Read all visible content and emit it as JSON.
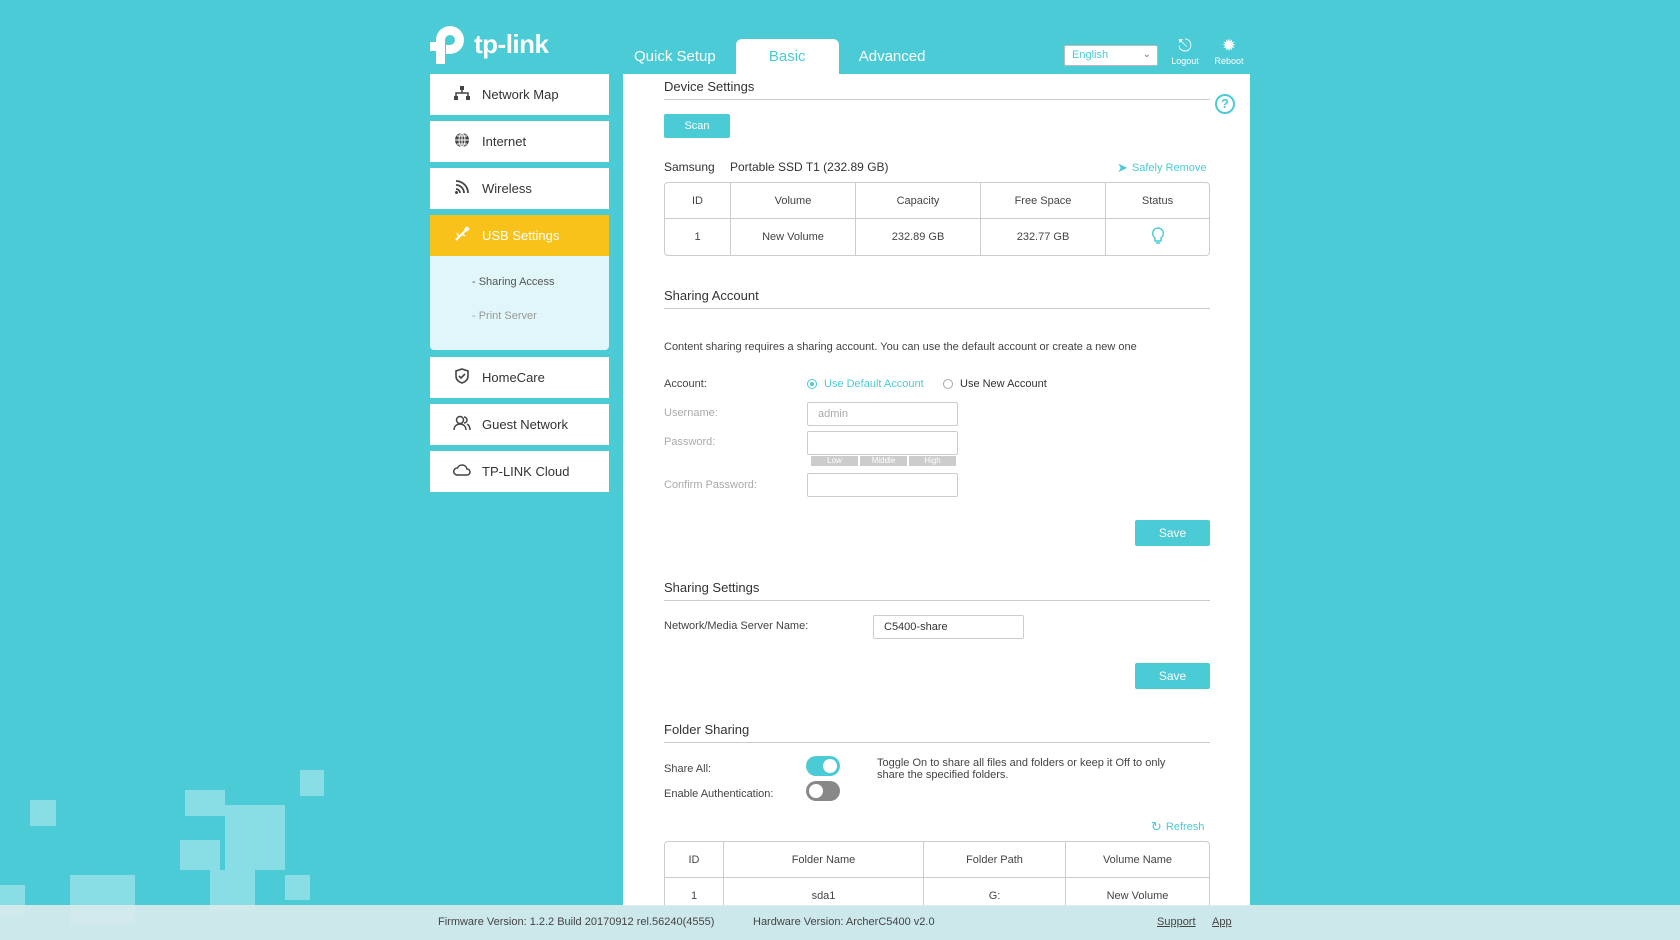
{
  "brand": {
    "name": "tp-link"
  },
  "topnav": {
    "tabs": [
      {
        "label": "Quick Setup"
      },
      {
        "label": "Basic"
      },
      {
        "label": "Advanced"
      }
    ]
  },
  "header": {
    "language": "English",
    "logout_label": "Logout",
    "reboot_label": "Reboot"
  },
  "sidebar": {
    "items": [
      {
        "label": "Network Map",
        "icon": "network-map-icon"
      },
      {
        "label": "Internet",
        "icon": "globe-icon"
      },
      {
        "label": "Wireless",
        "icon": "wifi-icon"
      },
      {
        "label": "USB Settings",
        "icon": "usb-icon"
      },
      {
        "label": "HomeCare",
        "icon": "shield-icon"
      },
      {
        "label": "Guest Network",
        "icon": "users-icon"
      },
      {
        "label": "TP-LINK Cloud",
        "icon": "cloud-icon"
      }
    ],
    "usb_sub": [
      {
        "label": "- Sharing Access"
      },
      {
        "label": "- Print Server"
      }
    ]
  },
  "device_settings": {
    "title": "Device Settings",
    "scan_label": "Scan",
    "device_brand": "Samsung",
    "device_model": "Portable SSD T1 (232.89 GB)",
    "safely_remove_label": "Safely Remove",
    "table": {
      "headers": [
        "ID",
        "Volume",
        "Capacity",
        "Free Space",
        "Status"
      ],
      "row": [
        "1",
        "New Volume",
        "232.89 GB",
        "232.77 GB"
      ]
    }
  },
  "sharing_account": {
    "title": "Sharing Account",
    "description": "Content sharing requires a sharing account. You can use the default account or create a new one",
    "account_label": "Account:",
    "option_default": "Use Default Account",
    "option_new": "Use New Account",
    "username_label": "Username:",
    "username_value": "admin",
    "password_label": "Password:",
    "strength": [
      "Low",
      "Middle",
      "High"
    ],
    "confirm_label": "Confirm Password:",
    "save_label": "Save"
  },
  "sharing_settings": {
    "title": "Sharing Settings",
    "server_name_label": "Network/Media Server Name:",
    "server_name_value": "C5400-share",
    "save_label": "Save"
  },
  "folder_sharing": {
    "title": "Folder Sharing",
    "share_all_label": "Share All:",
    "enable_auth_label": "Enable Authentication:",
    "hint": "Toggle On to share all files and folders or keep it Off to only share the specified folders.",
    "refresh_label": "Refresh",
    "table": {
      "headers": [
        "ID",
        "Folder Name",
        "Folder Path",
        "Volume Name"
      ],
      "row": [
        "1",
        "sda1",
        "G:",
        "New Volume"
      ]
    }
  },
  "footer": {
    "firmware": "Firmware Version: 1.2.2 Build 20170912 rel.56240(4555)",
    "hardware": "Hardware Version: ArcherC5400 v2.0",
    "support": "Support",
    "app": "App"
  },
  "colors": {
    "accent": "#4acbd6",
    "active_nav": "#f8c21b"
  }
}
